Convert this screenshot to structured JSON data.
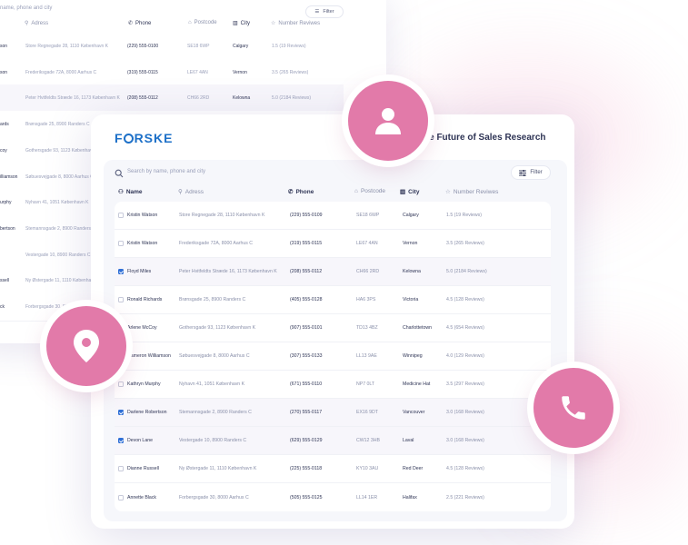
{
  "brand": {
    "logo_pre": "F",
    "logo_post": "RSKE",
    "accent": "#1d70c8",
    "bubble_color": "#e27aa9"
  },
  "title": "he Future of Sales Research",
  "search": {
    "placeholder": "Search by name, phone and city"
  },
  "filter_label": "Filter",
  "columns": [
    "Name",
    "Adress",
    "Phone",
    "Postcode",
    "City",
    "Number Reviwes"
  ],
  "rows": [
    {
      "name": "Kristin Watson",
      "address": "Store Regnegade 28, 1110 København K",
      "phone": "(229) 555-0109",
      "postcode": "SE18 6WP",
      "city": "Calgary",
      "reviews": "1.5 (19 Reviews)",
      "checked": false
    },
    {
      "name": "Kristin Watson",
      "address": "Frederiksgade 72A, 8000 Aarhus C",
      "phone": "(319) 555-0115",
      "postcode": "LE67 4AN",
      "city": "Vernon",
      "reviews": "3.5 (265 Reviews)",
      "checked": false
    },
    {
      "name": "Floyd Miles",
      "address": "Peter Hvitfeldts Stræde 16, 1173 København K",
      "phone": "(208) 555-0112",
      "postcode": "CH66 2RD",
      "city": "Kelowna",
      "reviews": "5.0 (2184 Reviews)",
      "checked": true
    },
    {
      "name": "Ronald Richards",
      "address": "Brønsgade 25, 8900 Randers C",
      "phone": "(405) 555-0128",
      "postcode": "HA6 3PS",
      "city": "Victoria",
      "reviews": "4.5 (128 Reviews)",
      "checked": false
    },
    {
      "name": "Arlene McCoy",
      "address": "Gothersgade 93, 1123 København K",
      "phone": "(907) 555-0101",
      "postcode": "TD13 4BZ",
      "city": "Charlottetown",
      "reviews": "4.5 (654 Reviews)",
      "checked": false
    },
    {
      "name": "Cameron Williamson",
      "address": "Søbuesvejgade 8, 8000 Aarhus C",
      "phone": "(307) 555-0133",
      "postcode": "LL13 9AE",
      "city": "Winnipeg",
      "reviews": "4.0 (129 Reviews)",
      "checked": false
    },
    {
      "name": "Kathryn Murphy",
      "address": "Nyhavn 41, 1051 København K",
      "phone": "(671) 555-0110",
      "postcode": "NP7 0LT",
      "city": "Medicine Hat",
      "reviews": "3.5 (297 Reviews)",
      "checked": false
    },
    {
      "name": "Darlene Robertson",
      "address": "Stemannsgade 2, 8900 Randers C",
      "phone": "(270) 555-0117",
      "postcode": "EX16 9DT",
      "city": "Vancouver",
      "reviews": "3.0 (168 Reviews)",
      "checked": true
    },
    {
      "name": "Devon Lane",
      "address": "Vestergade 10, 8900 Randers C",
      "phone": "(629) 555-0129",
      "postcode": "CW12 3HB",
      "city": "Laval",
      "reviews": "3.0 (168 Reviews)",
      "checked": true
    },
    {
      "name": "Dianne Russell",
      "address": "Ny Østergade 11, 1110 København K",
      "phone": "(225) 555-0118",
      "postcode": "KY10 3AU",
      "city": "Red Deer",
      "reviews": "4.5 (128 Reviews)",
      "checked": false
    },
    {
      "name": "Annette Black",
      "address": "Forbergsgade 30, 8000 Aarhus C",
      "phone": "(505) 555-0125",
      "postcode": "LL14 1ER",
      "city": "Halifax",
      "reviews": "2.5 (221 Reviews)",
      "checked": false
    }
  ],
  "back": {
    "search_partial": "name, phone and city",
    "filter_label": "Filter",
    "columns": [
      "Adress",
      "Phone",
      "Postcode",
      "City",
      "Number Reviwes"
    ],
    "rows": [
      {
        "name": "son",
        "address": "Store Regnegade 28, 1110 København K",
        "phone": "(229) 555-0100",
        "postcode": "SE18 6WP",
        "city": "Calgary",
        "reviews": "1.5 (19 Reviews)"
      },
      {
        "name": "son",
        "address": "Frederiksgade 72A, 8000 Aarhus C",
        "phone": "(319) 555-0115",
        "postcode": "LE67 4AN",
        "city": "Vernon",
        "reviews": "3.5 (265 Reviews)"
      },
      {
        "name": "",
        "address": "Peter Hvitfeldts Stræde 16, 1173 København K",
        "phone": "(208) 555-0112",
        "postcode": "CH66 2RD",
        "city": "Kelowna",
        "reviews": "5.0 (2184 Reviews)"
      },
      {
        "name": "ards",
        "address": "Brønsgade 25, 8900 Randers C",
        "phone": "",
        "postcode": "",
        "city": "",
        "reviews": ""
      },
      {
        "name": "coy",
        "address": "Gothersgade 93, 1123 København",
        "phone": "",
        "postcode": "",
        "city": "",
        "reviews": ""
      },
      {
        "name": "illiamson",
        "address": "Søbuesvejgade 8, 8000 Aarhus C",
        "phone": "",
        "postcode": "",
        "city": "",
        "reviews": ""
      },
      {
        "name": "urphy",
        "address": "Nyhavn 41, 1051 København K",
        "phone": "",
        "postcode": "",
        "city": "",
        "reviews": ""
      },
      {
        "name": "bertson",
        "address": "Stemannsgade 2, 8900 Randers C",
        "phone": "",
        "postcode": "",
        "city": "",
        "reviews": ""
      },
      {
        "name": "",
        "address": "Vestergade 10, 8900 Randers C",
        "phone": "",
        "postcode": "",
        "city": "",
        "reviews": ""
      },
      {
        "name": "ssell",
        "address": "Ny Østergade 11, 1110 København",
        "phone": "",
        "postcode": "",
        "city": "",
        "reviews": ""
      },
      {
        "name": "ck",
        "address": "Forbergsgade 30, 8000 Aarhus C",
        "phone": "",
        "postcode": "",
        "city": "",
        "reviews": ""
      }
    ]
  },
  "bubbles": {
    "top": "user-icon",
    "left": "location-pin-icon",
    "right": "phone-icon"
  }
}
